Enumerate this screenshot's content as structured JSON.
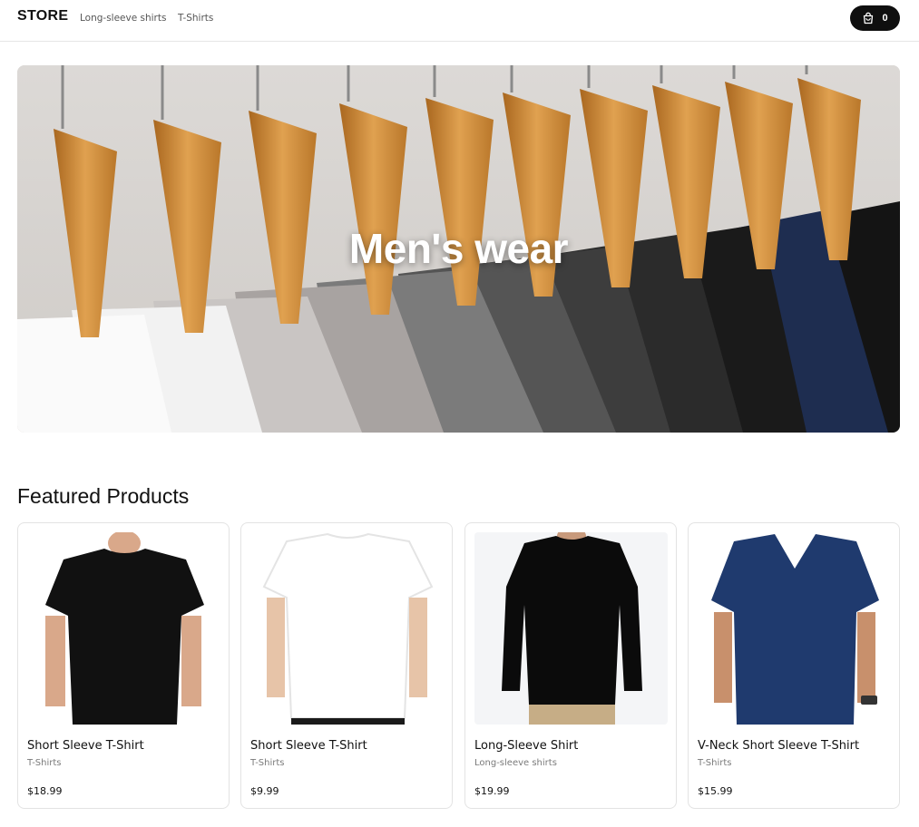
{
  "header": {
    "logo": "STORE",
    "nav": [
      {
        "label": "Long-sleeve shirts"
      },
      {
        "label": "T-Shirts"
      }
    ],
    "cart": {
      "icon": "shopping-bag-icon",
      "count": "0"
    }
  },
  "hero": {
    "title": "Men's wear"
  },
  "featured": {
    "title": "Featured Products",
    "products": [
      {
        "name": "Short Sleeve T-Shirt",
        "category": "T-Shirts",
        "price": "$18.99",
        "shirt_color": "#111111"
      },
      {
        "name": "Short Sleeve T-Shirt",
        "category": "T-Shirts",
        "price": "$9.99",
        "shirt_color": "#ffffff"
      },
      {
        "name": "Long-Sleeve Shirt",
        "category": "Long-sleeve shirts",
        "price": "$19.99",
        "shirt_color": "#0b0b0b"
      },
      {
        "name": "V-Neck Short Sleeve T-Shirt",
        "category": "T-Shirts",
        "price": "$15.99",
        "shirt_color": "#1f3a6e"
      }
    ]
  },
  "colors": {
    "accent": "#0f0f0f",
    "border": "#e3e3e3",
    "muted_text": "#7a7a7a"
  }
}
